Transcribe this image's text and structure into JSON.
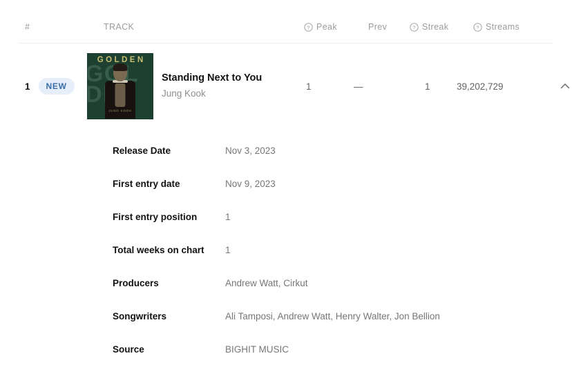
{
  "table": {
    "headers": {
      "rank": "#",
      "track": "TRACK",
      "peak": "Peak",
      "prev": "Prev",
      "streak": "Streak",
      "streams": "Streams"
    },
    "help_icon": "question-circle-icon"
  },
  "row": {
    "rank": "1",
    "badge": "NEW",
    "title": "Standing Next to You",
    "artist": "Jung Kook",
    "peak": "1",
    "prev": "—",
    "streak": "1",
    "streams": "39,202,729",
    "toggle_icon": "chevron-up-icon",
    "cover": {
      "album_title": "GOLDEN",
      "ghost_text": "GOL\nDEN",
      "footer_text": "JUNG KOOK",
      "bg_color": "#1d4031",
      "text_color": "#cbbe72"
    }
  },
  "details": [
    {
      "label": "Release Date",
      "value": "Nov 3, 2023"
    },
    {
      "label": "First entry date",
      "value": "Nov 9, 2023"
    },
    {
      "label": "First entry position",
      "value": "1"
    },
    {
      "label": "Total weeks on chart",
      "value": "1"
    },
    {
      "label": "Producers",
      "value": "Andrew Watt, Cirkut"
    },
    {
      "label": "Songwriters",
      "value": "Ali Tamposi, Andrew Watt, Henry Walter, Jon Bellion"
    },
    {
      "label": "Source",
      "value": "BIGHIT MUSIC"
    }
  ],
  "colors": {
    "badge_bg": "#e6eefa",
    "badge_text": "#3a6ea8",
    "divider": "#ececec",
    "muted_text": "#9b9b9b",
    "value_text": "#767676"
  }
}
